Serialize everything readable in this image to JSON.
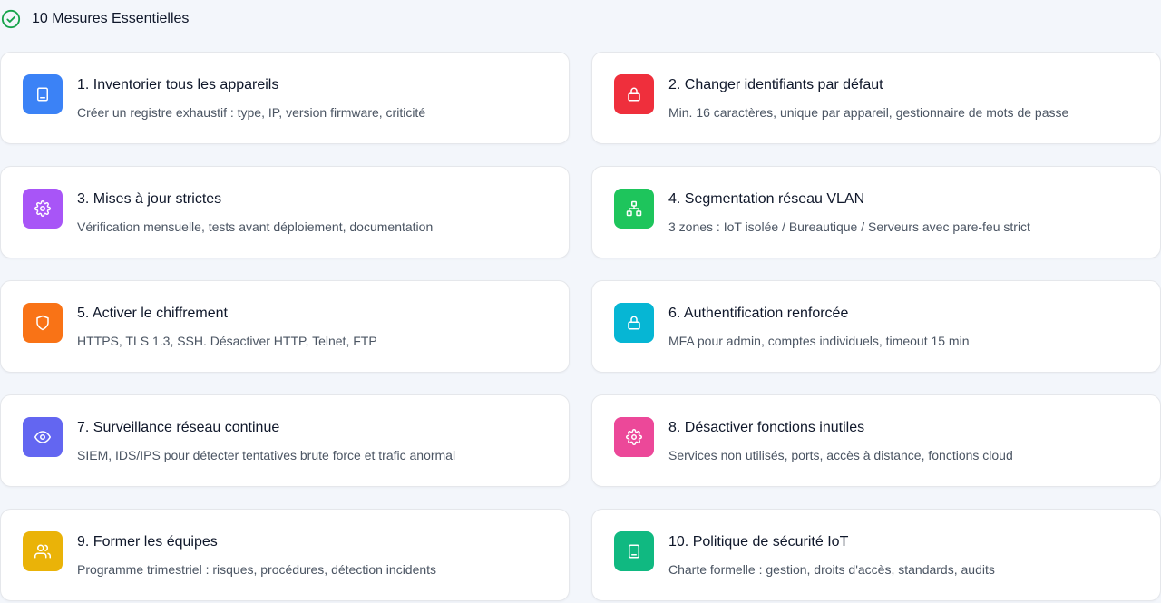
{
  "header": {
    "title": "10 Mesures Essentielles",
    "icon": "check-circle-icon",
    "icon_color": "#16a34a"
  },
  "measures": [
    {
      "title": "1. Inventorier tous les appareils",
      "description": "Créer un registre exhaustif : type, IP, version firmware, criticité",
      "icon": "book-icon",
      "color": "#3b82f6"
    },
    {
      "title": "2. Changer identifiants par défaut",
      "description": "Min. 16 caractères, unique par appareil, gestionnaire de mots de passe",
      "icon": "lock-icon",
      "color": "#ef2f3c"
    },
    {
      "title": "3. Mises à jour strictes",
      "description": "Vérification mensuelle, tests avant déploiement, documentation",
      "icon": "gear-icon",
      "color": "#a855f7"
    },
    {
      "title": "4. Segmentation réseau VLAN",
      "description": "3 zones : IoT isolée / Bureautique / Serveurs avec pare-feu strict",
      "icon": "network-icon",
      "color": "#1ec55c"
    },
    {
      "title": "5. Activer le chiffrement",
      "description": "HTTPS, TLS 1.3, SSH. Désactiver HTTP, Telnet, FTP",
      "icon": "shield-icon",
      "color": "#f97316"
    },
    {
      "title": "6. Authentification renforcée",
      "description": "MFA pour admin, comptes individuels, timeout 15 min",
      "icon": "lock-icon",
      "color": "#06b6d4"
    },
    {
      "title": "7. Surveillance réseau continue",
      "description": "SIEM, IDS/IPS pour détecter tentatives brute force et trafic anormal",
      "icon": "eye-icon",
      "color": "#6366f1"
    },
    {
      "title": "8. Désactiver fonctions inutiles",
      "description": "Services non utilisés, ports, accès à distance, fonctions cloud",
      "icon": "gear-icon",
      "color": "#ec4899"
    },
    {
      "title": "9. Former les équipes",
      "description": "Programme trimestriel : risques, procédures, détection incidents",
      "icon": "users-icon",
      "color": "#eab308"
    },
    {
      "title": "10. Politique de sécurité IoT",
      "description": "Charte formelle : gestion, droits d'accès, standards, audits",
      "icon": "book-icon",
      "color": "#10b981"
    }
  ]
}
